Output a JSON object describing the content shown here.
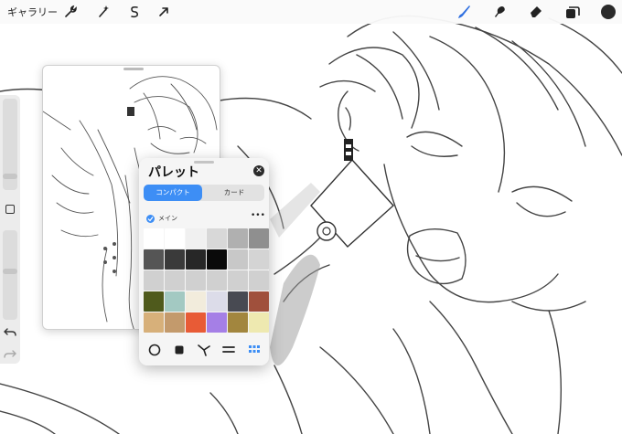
{
  "toolbar": {
    "gallery_label": "ギャラリー",
    "left_icons": [
      "wrench-icon",
      "magic-wand-icon",
      "selection-icon",
      "transform-arrow-icon"
    ],
    "right_icons": [
      "brush-icon",
      "smudge-icon",
      "eraser-icon",
      "layers-icon",
      "color-circle-icon"
    ],
    "accent": "#2f6fe0",
    "current_color": "#2a2a2a"
  },
  "sidebar": {
    "icons": [
      "square-modify-icon",
      "undo-icon",
      "redo-icon"
    ]
  },
  "palette": {
    "title": "パレット",
    "tab_compact": "コンパクト",
    "tab_card": "カード",
    "palette_name": "メイン",
    "more": "•••",
    "close": "✕",
    "swatches": [
      [
        "#ffffff",
        "#ffffff",
        "#f0f0f0",
        "#d8d8d8",
        "#b0b0b0",
        "#8f8f8f"
      ],
      [
        "#555555",
        "#3a3a3a",
        "#272727",
        "#0a0a0a",
        "#c8c8c8",
        "#d4d4d4"
      ],
      [
        "#d0d0d0",
        "#d0d0d0",
        "#d0d0d0",
        "#d0d0d0",
        "#d0d0d0",
        "#d0d0d0"
      ],
      [
        "#4f5a1c",
        "#a3c9c2",
        "#f2ecdc",
        "#dcdce9",
        "#484a52",
        "#a0503c"
      ],
      [
        "#d7b07a",
        "#c39a6c",
        "#e85b36",
        "#a57fe6",
        "#a2863e",
        "#eee9b0"
      ]
    ],
    "bottom_icons": [
      "circle-icon",
      "square-icon",
      "harmony-icon",
      "sliders-icon",
      "grid-icon"
    ]
  }
}
